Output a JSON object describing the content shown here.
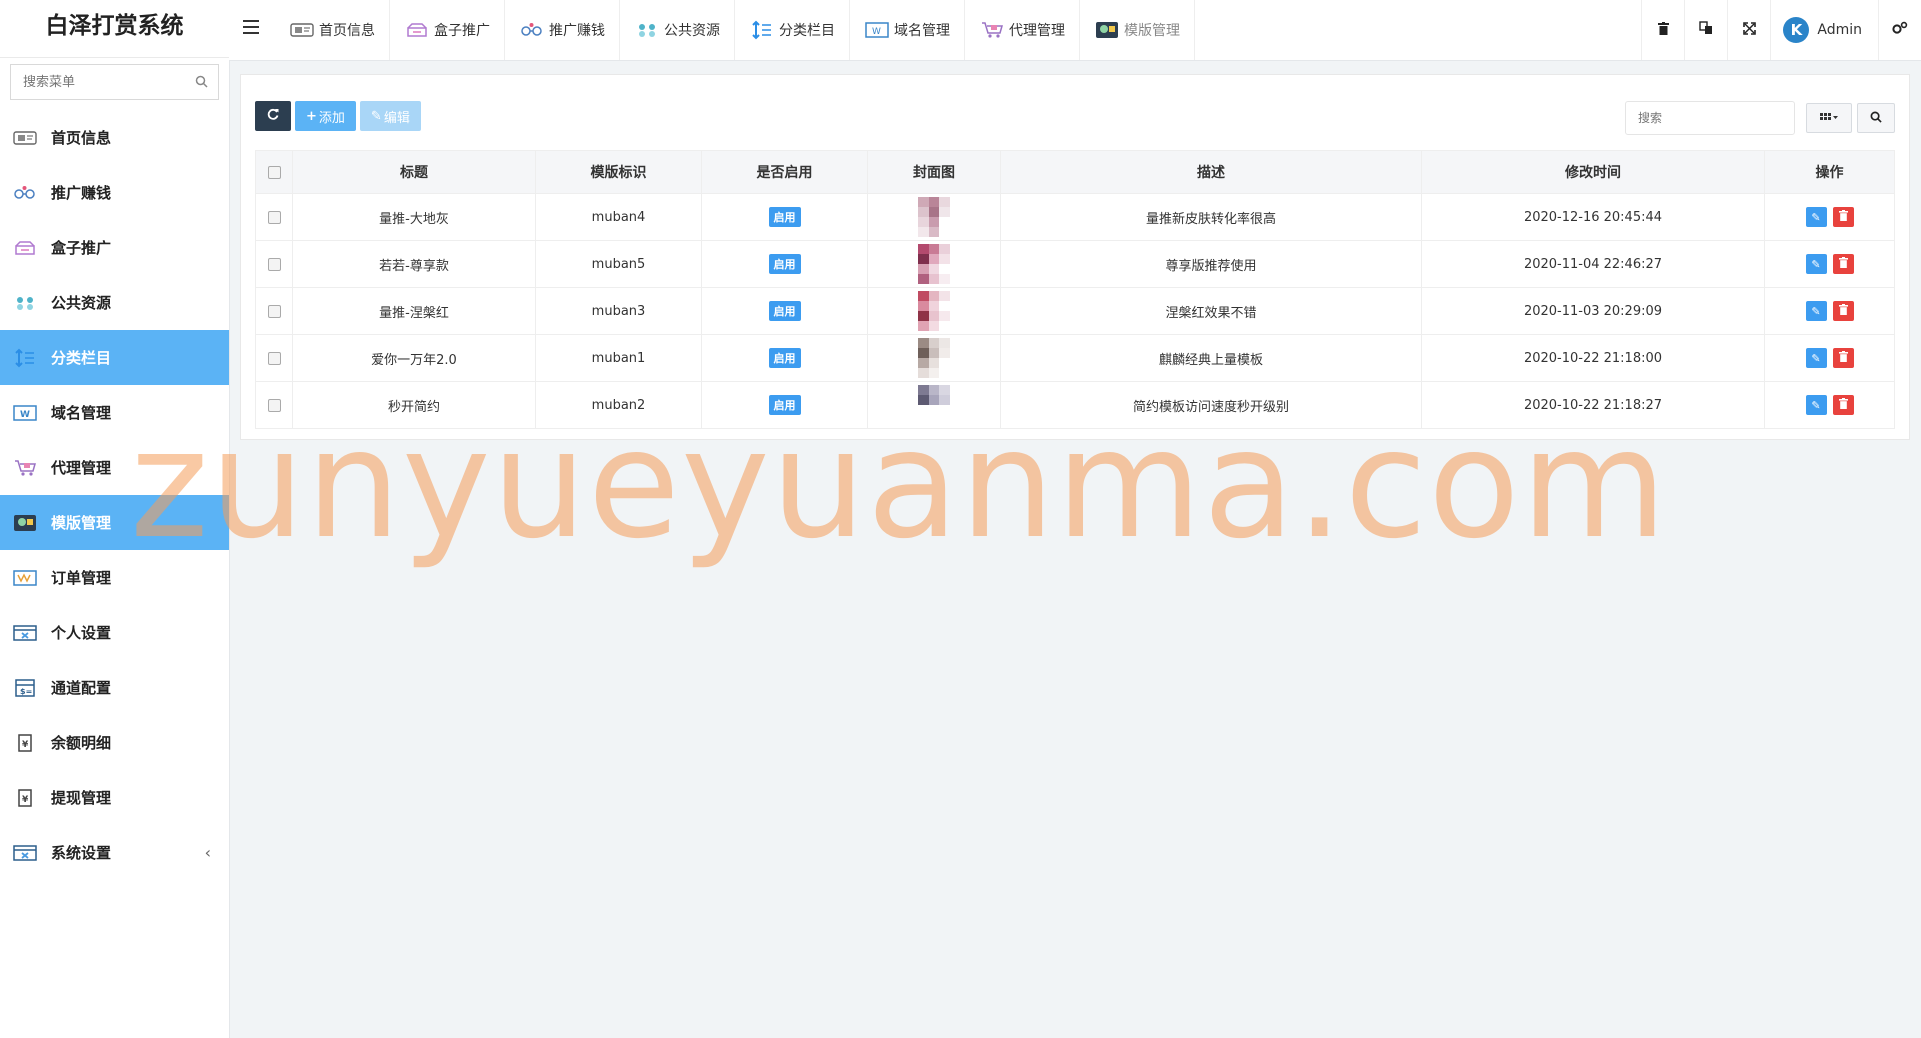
{
  "app": {
    "title": "白泽打赏系统"
  },
  "sidebar": {
    "search_placeholder": "搜索菜单",
    "items": [
      {
        "label": "首页信息",
        "icon": "home-info-icon",
        "active": false
      },
      {
        "label": "推广赚钱",
        "icon": "promote-earn-icon",
        "active": false
      },
      {
        "label": "盒子推广",
        "icon": "box-promote-icon",
        "active": false
      },
      {
        "label": "公共资源",
        "icon": "public-resource-icon",
        "active": false
      },
      {
        "label": "分类栏目",
        "icon": "category-icon",
        "active": true
      },
      {
        "label": "域名管理",
        "icon": "domain-icon",
        "active": false
      },
      {
        "label": "代理管理",
        "icon": "agent-icon",
        "active": false
      },
      {
        "label": "模版管理",
        "icon": "template-icon",
        "active": true
      },
      {
        "label": "订单管理",
        "icon": "order-icon",
        "active": false
      },
      {
        "label": "个人设置",
        "icon": "personal-settings-icon",
        "active": false
      },
      {
        "label": "通道配置",
        "icon": "channel-config-icon",
        "active": false
      },
      {
        "label": "余额明细",
        "icon": "balance-detail-icon",
        "active": false
      },
      {
        "label": "提现管理",
        "icon": "withdraw-icon",
        "active": false
      },
      {
        "label": "系统设置",
        "icon": "system-settings-icon",
        "active": false,
        "caret": "‹"
      }
    ]
  },
  "topbar": {
    "tabs": [
      {
        "label": "首页信息",
        "icon": "home-info-icon"
      },
      {
        "label": "盒子推广",
        "icon": "box-promote-icon"
      },
      {
        "label": "推广赚钱",
        "icon": "promote-earn-icon"
      },
      {
        "label": "公共资源",
        "icon": "public-resource-icon"
      },
      {
        "label": "分类栏目",
        "icon": "category-icon"
      },
      {
        "label": "域名管理",
        "icon": "domain-icon"
      },
      {
        "label": "代理管理",
        "icon": "agent-icon"
      },
      {
        "label": "模版管理",
        "icon": "template-icon"
      }
    ],
    "user": {
      "name": "Admin",
      "avatar_letter": "K"
    }
  },
  "toolbar": {
    "refresh_icon": "refresh-icon",
    "add_label": "添加",
    "edit_label": "编辑",
    "search_placeholder": "搜索"
  },
  "table": {
    "columns": [
      "标题",
      "模版标识",
      "是否启用",
      "封面图",
      "描述",
      "修改时间",
      "操作"
    ],
    "rows": [
      {
        "title": "量推-大地灰",
        "key": "muban4",
        "status": "启用",
        "desc": "量推新皮肤转化率很高",
        "time": "2020-12-16 20:45:44",
        "thumb": [
          "#cfa9b6",
          "#b98598",
          "#e9d8de",
          "#dcc3cc",
          "#a87488",
          "#f0e6ea",
          "#e8d5dc",
          "#c99cae",
          "#ffffff",
          "#f2e7eb",
          "#d9bac6",
          "#ffffff"
        ]
      },
      {
        "title": "若若-尊享款",
        "key": "muban5",
        "status": "启用",
        "desc": "尊享版推荐使用",
        "time": "2020-11-04 22:46:27",
        "thumb": [
          "#b34a6e",
          "#c97b95",
          "#ead0da",
          "#7f2f4d",
          "#e0a8bc",
          "#f3e2e8",
          "#d7a0b3",
          "#f0d8e1",
          "#ffffff",
          "#b0617f",
          "#e7c2cf",
          "#f7edf1"
        ]
      },
      {
        "title": "量推-涅槃红",
        "key": "muban3",
        "status": "启用",
        "desc": "涅槃红效果不错",
        "time": "2020-11-03 20:29:09",
        "thumb": [
          "#c04b62",
          "#e4b6c1",
          "#f3e3e8",
          "#d98a9e",
          "#f0d3dc",
          "#ffffff",
          "#8f3347",
          "#e8c3ce",
          "#f6e9ed",
          "#e0a3b3",
          "#f3dbe2",
          "#ffffff"
        ]
      },
      {
        "title": "爱你一万年2.0",
        "key": "muban1",
        "status": "启用",
        "desc": "麒麟经典上量模板",
        "time": "2020-10-22 21:18:00",
        "thumb": [
          "#9b8b84",
          "#d8cfcc",
          "#ece7e5",
          "#6e5f59",
          "#c9bebb",
          "#f1ecea",
          "#b7a9a4",
          "#e7e0dd",
          "#ffffff",
          "#e5ddda",
          "#f4f0ee",
          "#ffffff"
        ]
      },
      {
        "title": "秒开简约",
        "key": "muban2",
        "status": "启用",
        "desc": "简约模板访问速度秒开级别",
        "time": "2020-10-22 21:18:27",
        "thumb": [
          "#7e7a92",
          "#b9b6c8",
          "#d9d7e2",
          "#5d5a72",
          "#a8a5bb",
          "#cfcddb",
          "#ffffff",
          "#ffffff",
          "#ffffff",
          "#ffffff",
          "#ffffff",
          "#ffffff"
        ]
      }
    ]
  },
  "watermark": "zunyueyuanma.com",
  "colors": {
    "accent": "#5bb3f5",
    "enable_badge": "#3c9cf0",
    "delete": "#e8423d",
    "dark_button": "#2c3e50"
  }
}
